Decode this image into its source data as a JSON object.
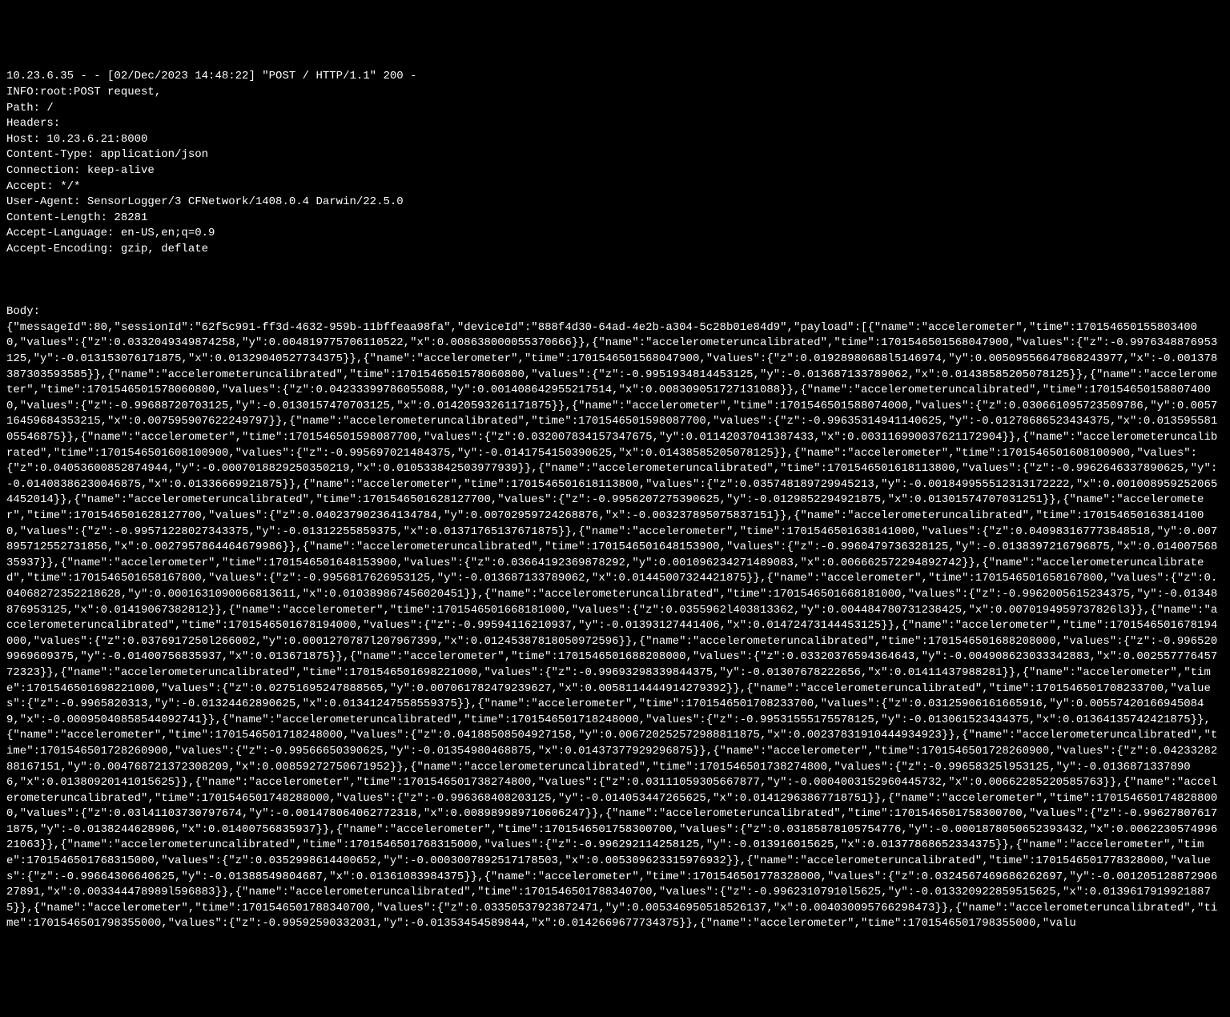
{
  "log": {
    "access_line": "10.23.6.35 - - [02/Dec/2023 14:48:22] \"POST / HTTP/1.1\" 200 -",
    "info_line": "INFO:root:POST request,",
    "path_line": "Path: /",
    "headers_label": "Headers:",
    "headers": {
      "host": "Host: 10.23.6.21:8000",
      "content_type": "Content-Type: application/json",
      "connection": "Connection: keep-alive",
      "accept": "Accept: */*",
      "user_agent": "User-Agent: SensorLogger/3 CFNetwork/1408.0.4 Darwin/22.5.0",
      "content_length": "Content-Length: 28281",
      "accept_language": "Accept-Language: en-US,en;q=0.9",
      "accept_encoding": "Accept-Encoding: gzip, deflate"
    },
    "body_label": "Body:",
    "body_json": "{\"messageId\":80,\"sessionId\":\"62f5c991-ff3d-4632-959b-11bffeaa98fa\",\"deviceId\":\"888f4d30-64ad-4e2b-a304-5c28b01e84d9\",\"payload\":[{\"name\":\"accelerometer\",\"time\":1701546501558034000,\"values\":{\"z\":0.0332049349874258,\"y\":0.004819775706110522,\"x\":0.008638000055370666}},{\"name\":\"accelerometeruncalibrated\",\"time\":1701546501568047900,\"values\":{\"z\":-0.9976348876953125,\"y\":-0.013153076171875,\"x\":0.01329040527734375}},{\"name\":\"accelerometer\",\"time\":1701546501568047900,\"values\":{\"z\":0.01928980688l5146974,\"y\":0.00509556647868243977,\"x\":-0.001378387303593585}},{\"name\":\"accelerometeruncalibrated\",\"time\":1701546501578060800,\"values\":{\"z\":-0.9951934814453125,\"y\":-0.013687133789062,\"x\":0.01438585205078125}},{\"name\":\"accelerometer\",\"time\":1701546501578060800,\"values\":{\"z\":0.04233399786055088,\"y\":0.001408642955217514,\"x\":0.008309051727131088}},{\"name\":\"accelerometeruncalibrated\",\"time\":1701546501588074000,\"values\":{\"z\":-0.99688720703125,\"y\":-0.0130157470703125,\"x\":0.01420593261171875}},{\"name\":\"accelerometer\",\"time\":1701546501588074000,\"values\":{\"z\":0.030661095723509786,\"y\":0.005716459684353215,\"x\":0.007595907622249797}},{\"name\":\"accelerometeruncalibrated\",\"time\":1701546501598087700,\"values\":{\"z\":-0.99635314941140625,\"y\":-0.01278686523434375,\"x\":0.01359558105546875}},{\"name\":\"accelerometer\",\"time\":1701546501598087700,\"values\":{\"z\":0.032007834157347675,\"y\":0.01142037041387433,\"x\":0.003116990037621172904}},{\"name\":\"accelerometeruncalibrated\",\"time\":1701546501608100900,\"values\":{\"z\":-0.995697021484375,\"y\":-0.0141754150390625,\"x\":0.01438585205078125}},{\"name\":\"accelerometer\",\"time\":1701546501608100900,\"values\":{\"z\":0.04053600852874944,\"y\":-0.0007018829250350219,\"x\":0.010533842503977939}},{\"name\":\"accelerometeruncalibrated\",\"time\":1701546501618113800,\"values\":{\"z\":-0.9962646337890625,\"y\":-0.01408386230046875,\"x\":0.01336669921875}},{\"name\":\"accelerometer\",\"time\":1701546501618113800,\"values\":{\"z\":0.035748189729945213,\"y\":-0.001849955512313172222,\"x\":0.0010089592520654452014}},{\"name\":\"accelerometeruncalibrated\",\"time\":1701546501628127700,\"values\":{\"z\":-0.9956207275390625,\"y\":-0.0129852294921875,\"x\":0.01301574707031251}},{\"name\":\"accelerometer\",\"time\":1701546501628127700,\"values\":{\"z\":0.040237902364134784,\"y\":0.00702959724268876,\"x\":-0.003237895075837151}},{\"name\":\"accelerometeruncalibrated\",\"time\":1701546501638141000,\"values\":{\"z\":-0.99571228027343375,\"y\":-0.01312255859375,\"x\":0.01371765137671875}},{\"name\":\"accelerometer\",\"time\":1701546501638141000,\"values\":{\"z\":0.040983167773848518,\"y\":0.007895712552731856,\"x\":0.0027957864464679986}},{\"name\":\"accelerometeruncalibrated\",\"time\":1701546501648153900,\"values\":{\"z\":-0.9960479736328125,\"y\":-0.0138397216796875,\"x\":0.01400756835937}},{\"name\":\"accelerometer\",\"time\":1701546501648153900,\"values\":{\"z\":0.03664192369878292,\"y\":0.001096234271489083,\"x\":0.006662572294892742}},{\"name\":\"accelerometeruncalibrated\",\"time\":1701546501658167800,\"values\":{\"z\":-0.9956817626953125,\"y\":-0.013687133789062,\"x\":0.01445007324421875}},{\"name\":\"accelerometer\",\"time\":1701546501658167800,\"values\":{\"z\":0.04068272352218628,\"y\":0.0001631090066813611,\"x\":0.010389867456020451}},{\"name\":\"accelerometeruncalibrated\",\"time\":1701546501668181000,\"values\":{\"z\":-0.9962005615234375,\"y\":-0.01348876953125,\"x\":0.01419067382812}},{\"name\":\"accelerometer\",\"time\":1701546501668181000,\"values\":{\"z\":0.0355962l403813362,\"y\":0.004484780731238425,\"x\":0.0070194959737826l3}},{\"name\":\"accelerometeruncalibrated\",\"time\":1701546501678194000,\"values\":{\"z\":-0.99594116210937,\"y\":-0.01393127441406,\"x\":0.01472473144453125}},{\"name\":\"accelerometer\",\"time\":1701546501678194000,\"values\":{\"z\":0.0376917250l266002,\"y\":0.0001270787l207967399,\"x\":0.01245387818050972596}},{\"name\":\"accelerometeruncalibrated\",\"time\":1701546501688208000,\"values\":{\"z\":-0.9965209969609375,\"y\":-0.01400756835937,\"x\":0.013671875}},{\"name\":\"accelerometer\",\"time\":1701546501688208000,\"values\":{\"z\":0.03320376594364643,\"y\":-0.004908623033342883,\"x\":0.00255777645772323}},{\"name\":\"accelerometeruncalibrated\",\"time\":1701546501698221000,\"values\":{\"z\":-0.99693298339844375,\"y\":-0.01307678222656,\"x\":0.01411437988281}},{\"name\":\"accelerometer\",\"time\":1701546501698221000,\"values\":{\"z\":0.02751695247888565,\"y\":0.007061782479239627,\"x\":0.0058114444914279392}},{\"name\":\"accelerometeruncalibrated\",\"time\":1701546501708233700,\"values\":{\"z\":-0.9965820313,\"y\":-0.01324462890625,\"x\":0.01341247558559375}},{\"name\":\"accelerometer\",\"time\":1701546501708233700,\"values\":{\"z\":0.03125906161665916,\"y\":0.005574201669450849,\"x\":-0.00095040858544092741}},{\"name\":\"accelerometeruncalibrated\",\"time\":1701546501718248000,\"values\":{\"z\":-0.99531555175578125,\"y\":-0.013061523434375,\"x\":0.01364135742421875}},{\"name\":\"accelerometer\",\"time\":1701546501718248000,\"values\":{\"z\":0.04188508504927158,\"y\":0.006720252572988811875,\"x\":0.00237831910444934923}},{\"name\":\"accelerometeruncalibrated\",\"time\":1701546501728260900,\"values\":{\"z\":-0.99566650390625,\"y\":-0.01354980468875,\"x\":0.01437377929296875}},{\"name\":\"accelerometer\",\"time\":1701546501728260900,\"values\":{\"z\":0.0423328288167151,\"y\":0.004768721372308209,\"x\":0.00859272750671952}},{\"name\":\"accelerometeruncalibrated\",\"time\":1701546501738274800,\"values\":{\"z\":-0.99658325l953125,\"y\":-0.01368713378906,\"x\":0.01380920141015625}},{\"name\":\"accelerometer\",\"time\":1701546501738274800,\"values\":{\"z\":0.03111059305667877,\"y\":-0.0004003152960445732,\"x\":0.00662285220585763}},{\"name\":\"accelerometeruncalibrated\",\"time\":1701546501748288000,\"values\":{\"z\":-0.996368408203125,\"y\":-0.014053447265625,\"x\":0.01412963867718751}},{\"name\":\"accelerometer\",\"time\":1701546501748288000,\"values\":{\"z\":0.03l41103730797674,\"y\":-0.001478064062772318,\"x\":0.008989989710606247}},{\"name\":\"accelerometeruncalibrated\",\"time\":1701546501758300700,\"values\":{\"z\":-0.996278076171875,\"y\":-0.0138244628906,\"x\":0.01400756835937}},{\"name\":\"accelerometer\",\"time\":1701546501758300700,\"values\":{\"z\":0.03185878105754776,\"y\":-0.0001878050652393432,\"x\":0.006223057499621063}},{\"name\":\"accelerometeruncalibrated\",\"time\":1701546501768315000,\"values\":{\"z\":-0.996292114258125,\"y\":-0.013916015625,\"x\":0.01377868652334375}},{\"name\":\"accelerometer\",\"time\":1701546501768315000,\"values\":{\"z\":0.0352998614400652,\"y\":-0.0003007892517178503,\"x\":0.005309623315976932}},{\"name\":\"accelerometeruncalibrated\",\"time\":1701546501778328000,\"values\":{\"z\":-0.99664306640625,\"y\":-0.01388549804687,\"x\":0.01361083984375}},{\"name\":\"accelerometer\",\"time\":1701546501778328000,\"values\":{\"z\":0.0324567469686262697,\"y\":-0.00120512887290627891,\"x\":0.003344478989l596883}},{\"name\":\"accelerometeruncalibrated\",\"time\":1701546501788340700,\"values\":{\"z\":-0.99623107910l5625,\"y\":-0.013320922859515625,\"x\":0.01396179199218875}},{\"name\":\"accelerometer\",\"time\":1701546501788340700,\"values\":{\"z\":0.03350537923872471,\"y\":0.005346950518526137,\"x\":0.004030095766298473}},{\"name\":\"accelerometeruncalibrated\",\"time\":1701546501798355000,\"values\":{\"z\":-0.99592590332031,\"y\":-0.01353454589844,\"x\":0.0142669677734375}},{\"name\":\"accelerometer\",\"time\":1701546501798355000,\"valu"
  }
}
